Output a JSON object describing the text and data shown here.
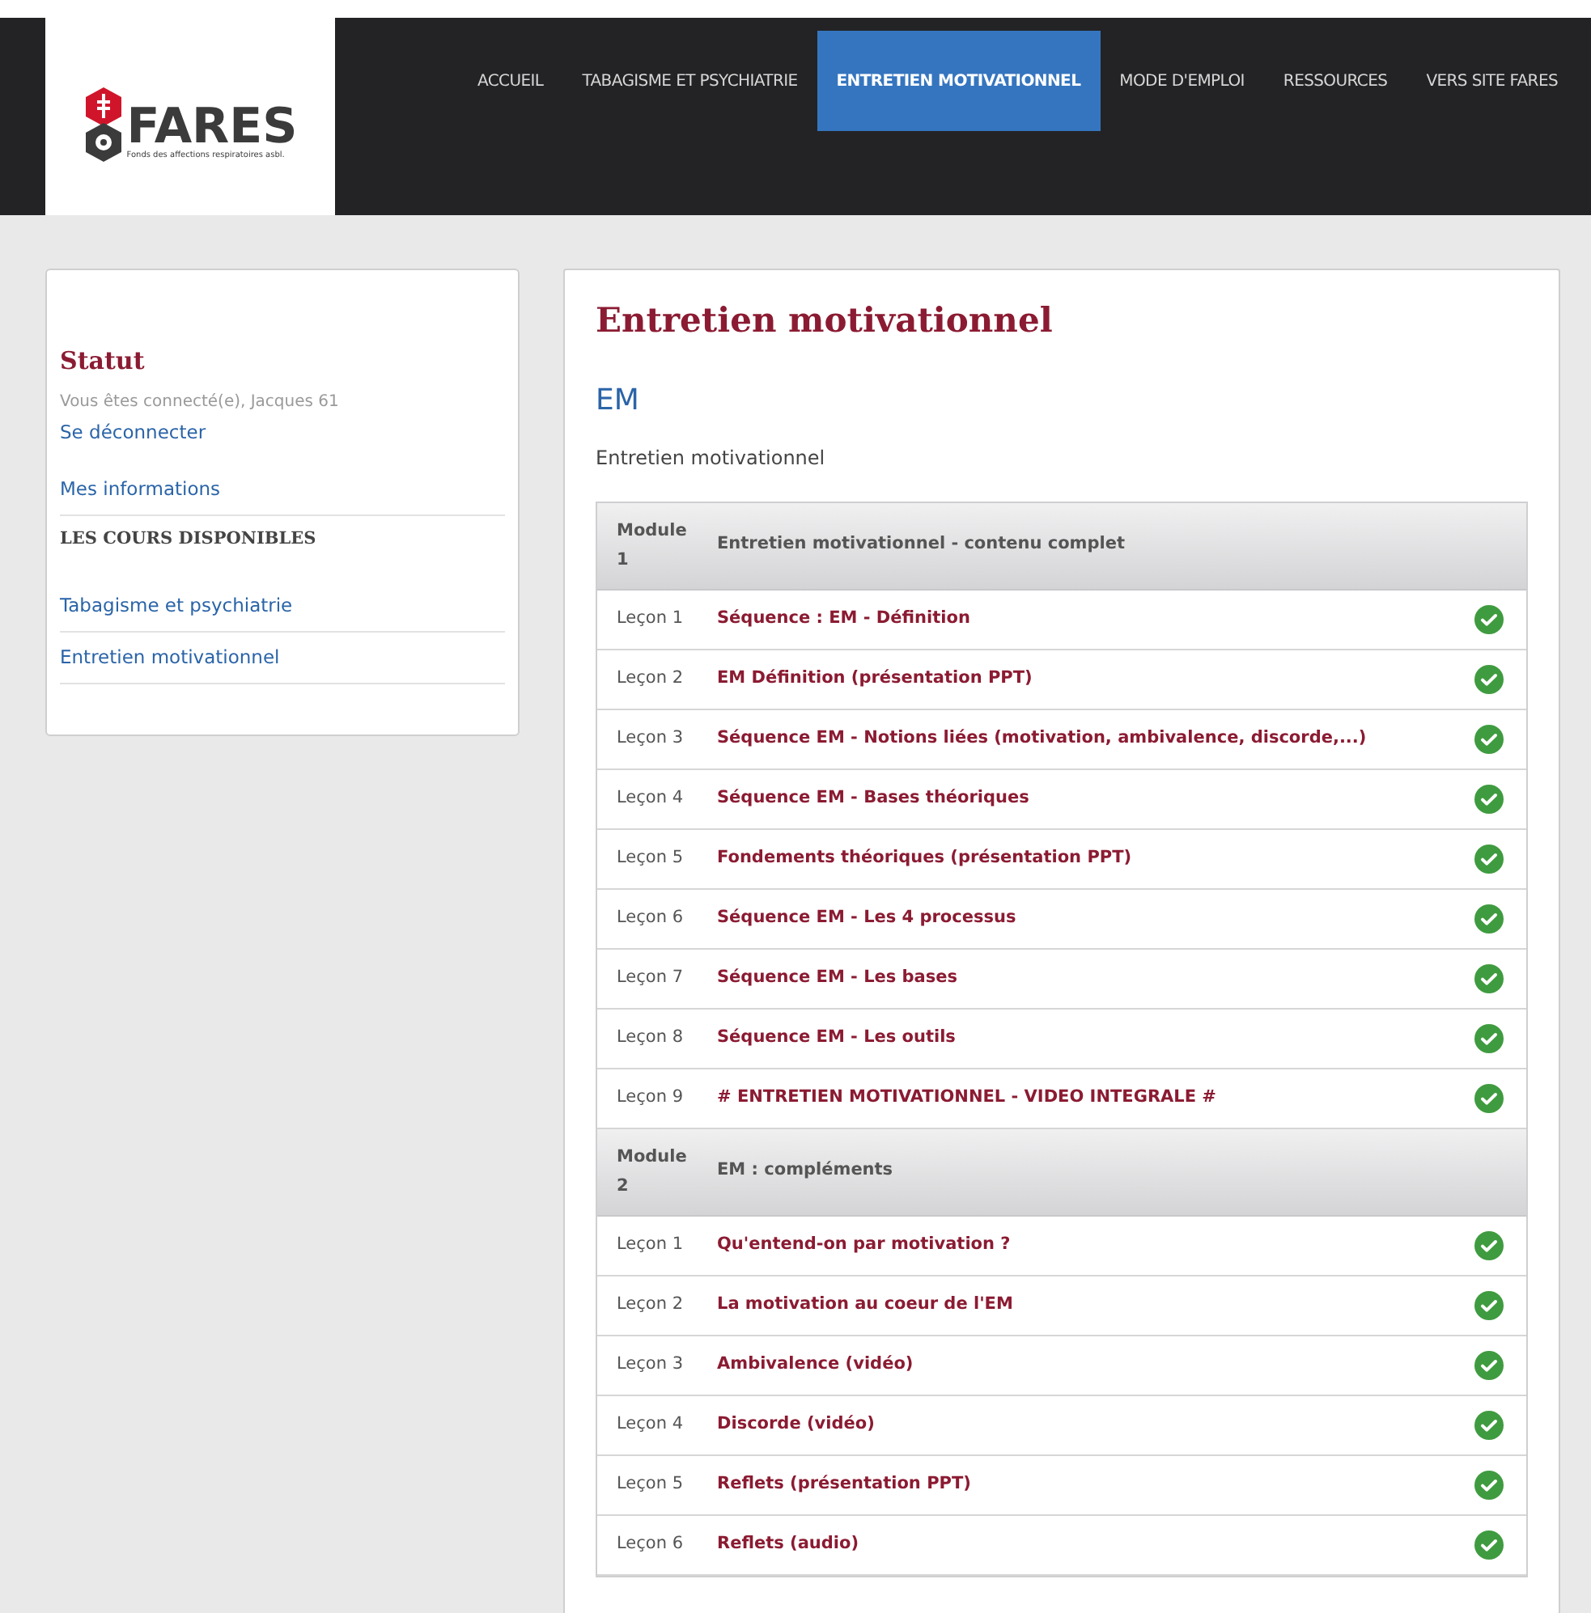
{
  "logo": {
    "name": "FARES",
    "tagline": "Fonds des affections respiratoires asbl."
  },
  "nav": [
    {
      "label": "ACCUEIL",
      "selected": false
    },
    {
      "label": "TABAGISME ET PSYCHIATRIE",
      "selected": false
    },
    {
      "label": "ENTRETIEN MOTIVATIONNEL",
      "selected": true
    },
    {
      "label": "MODE D'EMPLOI",
      "selected": false
    },
    {
      "label": "RESSOURCES",
      "selected": false
    },
    {
      "label": "VERS SITE FARES",
      "selected": false
    }
  ],
  "sidebar": {
    "title": "Statut",
    "status": "Vous êtes connecté(e), Jacques 61",
    "logout": "Se déconnecter",
    "profile": "Mes informations",
    "courses_heading": "LES COURS DISPONIBLES",
    "courses": [
      "Tabagisme et psychiatrie",
      "Entretien motivationnel"
    ]
  },
  "main": {
    "title": "Entretien motivationnel",
    "course_code": "EM",
    "description": "Entretien motivationnel",
    "modules": [
      {
        "label": "Module 1",
        "title": "Entretien motivationnel - contenu complet",
        "lessons": [
          {
            "label": "Leçon 1",
            "title": "Séquence : EM - Définition",
            "completed": true
          },
          {
            "label": "Leçon 2",
            "title": "EM Définition (présentation PPT)",
            "completed": true
          },
          {
            "label": "Leçon 3",
            "title": "Séquence EM - Notions liées (motivation, ambivalence, discorde,...)",
            "completed": true
          },
          {
            "label": "Leçon 4",
            "title": "Séquence EM - Bases théoriques",
            "completed": true
          },
          {
            "label": "Leçon 5",
            "title": "Fondements théoriques (présentation PPT)",
            "completed": true
          },
          {
            "label": "Leçon 6",
            "title": "Séquence EM - Les 4 processus",
            "completed": true
          },
          {
            "label": "Leçon 7",
            "title": "Séquence EM - Les bases",
            "completed": true
          },
          {
            "label": "Leçon 8",
            "title": "Séquence EM - Les outils",
            "completed": true
          },
          {
            "label": "Leçon 9",
            "title": "# ENTRETIEN MOTIVATIONNEL - VIDEO INTEGRALE #",
            "completed": true
          }
        ]
      },
      {
        "label": "Module 2",
        "title": "EM : compléments",
        "lessons": [
          {
            "label": "Leçon 1",
            "title": "Qu'entend-on par motivation ?",
            "completed": true
          },
          {
            "label": "Leçon 2",
            "title": "La motivation au coeur de l'EM",
            "completed": true
          },
          {
            "label": "Leçon 3",
            "title": "Ambivalence (vidéo)",
            "completed": true
          },
          {
            "label": "Leçon 4",
            "title": "Discorde (vidéo)",
            "completed": true
          },
          {
            "label": "Leçon 5",
            "title": "Reflets (présentation PPT)",
            "completed": true
          },
          {
            "label": "Leçon 6",
            "title": "Reflets (audio)",
            "completed": true
          }
        ]
      }
    ]
  }
}
